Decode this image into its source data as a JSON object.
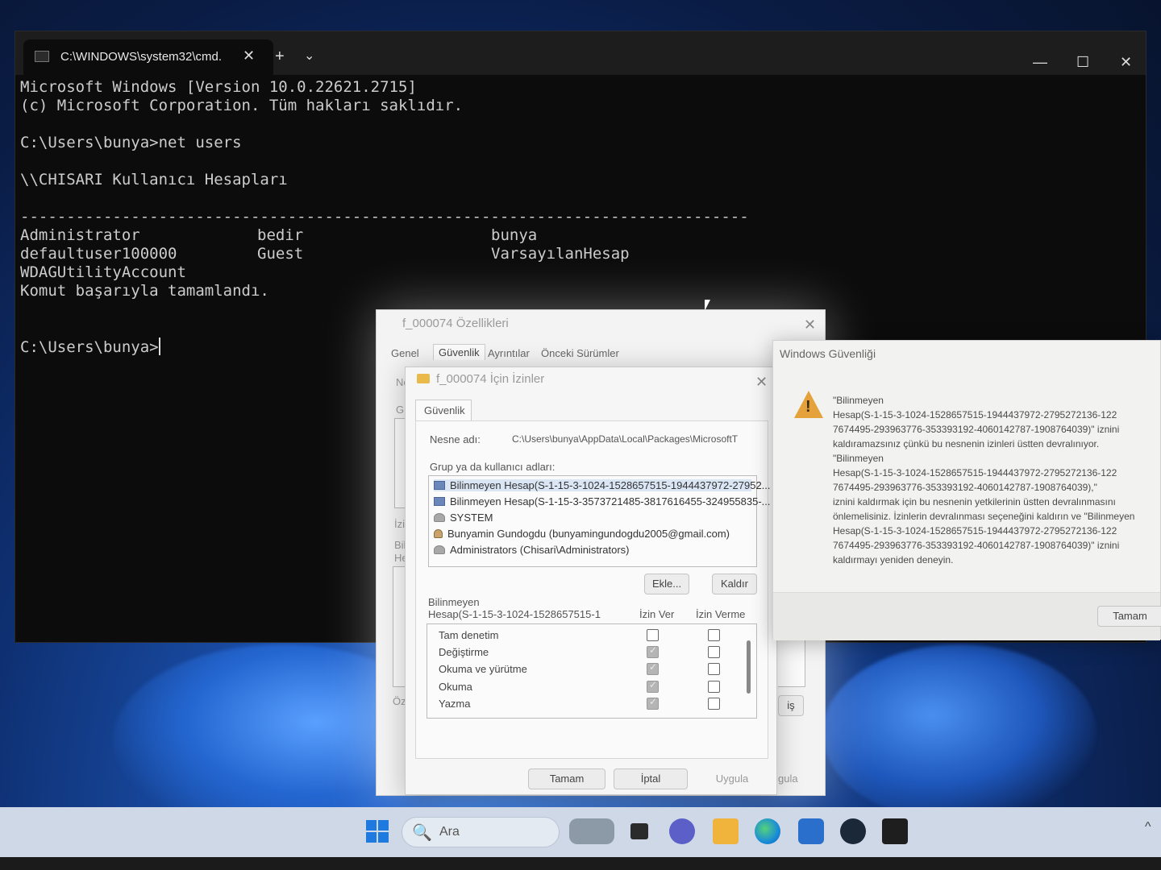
{
  "cmd": {
    "tab_title": "C:\\WINDOWS\\system32\\cmd.",
    "tab_close": "✕",
    "new_tab": "+",
    "dropdown": "⌄",
    "minimize": "—",
    "maximize": "☐",
    "close": "✕",
    "lines": [
      "Microsoft Windows [Version 10.0.22621.2715]",
      "(c) Microsoft Corporation. Tüm hakları saklıdır.",
      "C:\\Users\\bunya>net users",
      "\\\\CHISARI Kullanıcı Hesapları",
      "-------------------------------------------------------------------------------",
      "Komut başarıyla tamamlandı.",
      "C:\\Users\\bunya>"
    ],
    "users": {
      "col1": [
        "Administrator",
        "defaultuser100000",
        "WDAGUtilityAccount"
      ],
      "col2": [
        "bedir",
        "Guest"
      ],
      "col3": [
        "bunya",
        "VarsayılanHesap"
      ]
    }
  },
  "props": {
    "title": "f_000074 Özellikleri",
    "close": "✕",
    "tabs": [
      "Genel",
      "Güvenlik",
      "Ayrıntılar",
      "Önceki Sürümler"
    ],
    "partial_labels": [
      "Ne",
      "Gr",
      "İzi",
      "Bil",
      "He",
      "Öz"
    ],
    "apply_partial": "gula",
    "adv_partial": "iş"
  },
  "perms": {
    "title": "f_000074 İçin İzinler",
    "close": "✕",
    "tab": "Güvenlik",
    "object_label": "Nesne adı:",
    "object_value": "C:\\Users\\bunya\\AppData\\Local\\Packages\\MicrosoftT",
    "group_label": "Grup ya da kullanıcı adları:",
    "accounts": [
      "Bilinmeyen Hesap(S-1-15-3-1024-1528657515-1944437972-27952...",
      "Bilinmeyen Hesap(S-1-15-3-3573721485-3817616455-324955835-...",
      "SYSTEM",
      "Bunyamin Gundogdu (bunyamingundogdu2005@gmail.com)",
      "Administrators (Chisari\\Administrators)"
    ],
    "add_button": "Ekle...",
    "remove_button": "Kaldır",
    "perm_for_line1": "Bilinmeyen",
    "perm_for_line2": "Hesap(S-1-15-3-1024-1528657515-1",
    "allow_header": "İzin Ver",
    "deny_header": "İzin Verme",
    "permissions": [
      "Tam denetim",
      "Değiştirme",
      "Okuma ve yürütme",
      "Okuma",
      "Yazma"
    ],
    "ok_button": "Tamam",
    "cancel_button": "İptal",
    "apply_button": "Uygula"
  },
  "alert": {
    "title": "Windows Güvenliği",
    "message_lines": [
      "\"Bilinmeyen",
      "Hesap(S-1-15-3-1024-1528657515-1944437972-2795272136-122",
      "7674495-293963776-353393192-4060142787-1908764039)\" iznini",
      "kaldıramazsınız çünkü bu nesnenin izinleri üstten devralınıyor.",
      "\"Bilinmeyen",
      "Hesap(S-1-15-3-1024-1528657515-1944437972-2795272136-122",
      "7674495-293963776-353393192-4060142787-1908764039),\"",
      "iznini kaldırmak için bu nesnenin yetkilerinin üstten devralınmasını",
      "önlemelisiniz.  İzinlerin devralınması seçeneğini kaldırın ve \"Bilinmeyen",
      "Hesap(S-1-15-3-1024-1528657515-1944437972-2795272136-122",
      "7674495-293963776-353393192-4060142787-1908764039)\" iznini",
      "kaldırmayı yeniden deneyin."
    ],
    "ok_button": "Tamam"
  },
  "taskbar": {
    "search_placeholder": "Ara",
    "search_icon": "🔍"
  },
  "colors": {
    "cmd_bg": "#0c0c0c",
    "cmd_text": "#cccccc",
    "warn": "#e6a23a",
    "taskbar": "#cfd8e6"
  }
}
